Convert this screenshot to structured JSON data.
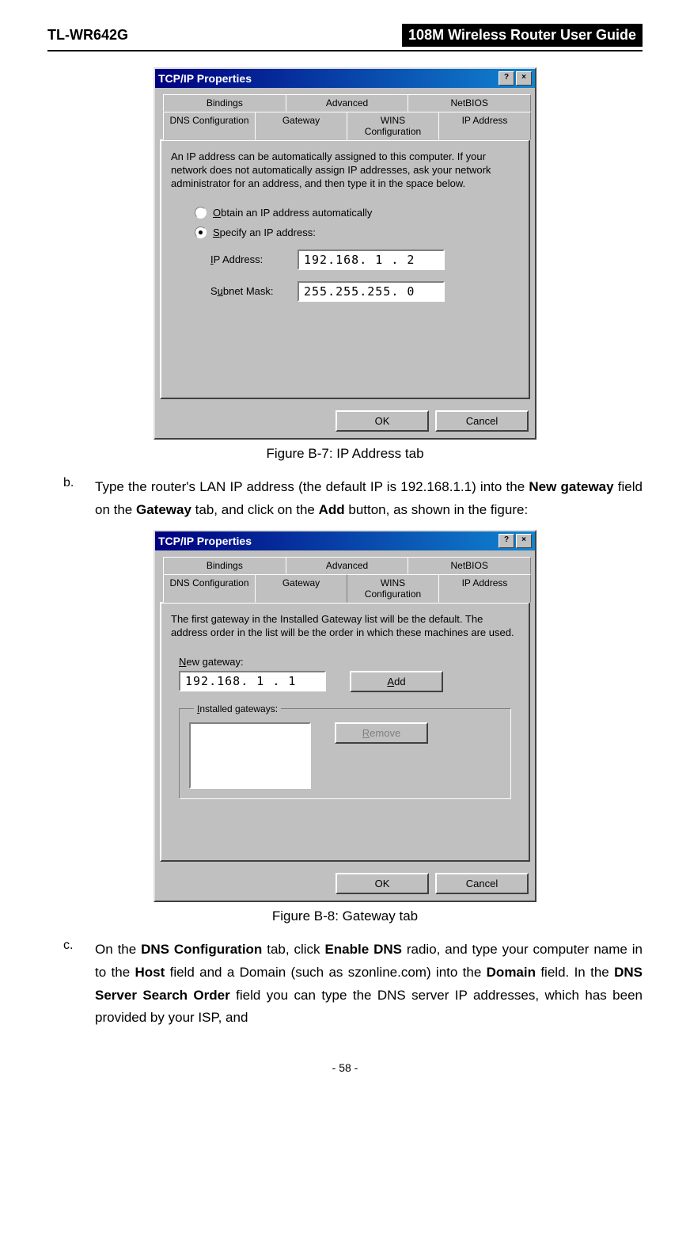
{
  "header": {
    "left": "TL-WR642G",
    "right": "108M Wireless Router User Guide"
  },
  "dialog1": {
    "title": "TCP/IP Properties",
    "help_btn": "?",
    "close_btn": "×",
    "tabs_row1": [
      "Bindings",
      "Advanced",
      "NetBIOS"
    ],
    "tabs_row2": [
      "DNS Configuration",
      "Gateway",
      "WINS Configuration",
      "IP Address"
    ],
    "description": "An IP address can be automatically assigned to this computer. If your network does not automatically assign IP addresses, ask your network administrator for an address, and then type it in the space below.",
    "radio_obtain": "Obtain an IP address automatically",
    "radio_specify": "Specify an IP address:",
    "ip_label": "IP Address:",
    "ip_value": "192.168. 1 . 2",
    "subnet_label": "Subnet Mask:",
    "subnet_value": "255.255.255. 0",
    "ok": "OK",
    "cancel": "Cancel"
  },
  "caption1": "Figure B-7: IP Address tab",
  "step_b": {
    "marker": "b.",
    "text_pre": "Type the router's LAN IP address (the default IP is 192.168.1.1) into the ",
    "bold1": "New gateway",
    "text_mid1": " field on the ",
    "bold2": "Gateway",
    "text_mid2": " tab, and click on the ",
    "bold3": "Add",
    "text_end": " button, as shown in the figure:"
  },
  "dialog2": {
    "title": "TCP/IP Properties",
    "help_btn": "?",
    "close_btn": "×",
    "tabs_row1": [
      "Bindings",
      "Advanced",
      "NetBIOS"
    ],
    "tabs_row2": [
      "DNS Configuration",
      "Gateway",
      "WINS Configuration",
      "IP Address"
    ],
    "description": "The first gateway in the Installed Gateway list will be the default. The address order in the list will be the order in which these machines are used.",
    "new_gateway_label": "New gateway:",
    "new_gateway_value": "192.168. 1 . 1",
    "add": "Add",
    "installed_label": "Installed gateways:",
    "remove": "Remove",
    "ok": "OK",
    "cancel": "Cancel"
  },
  "caption2": "Figure B-8: Gateway tab",
  "step_c": {
    "marker": "c.",
    "text1": "On the ",
    "bold1": "DNS Configuration",
    "text2": " tab, click ",
    "bold2": "Enable DNS",
    "text3": " radio, and type your computer name in to the ",
    "bold3": "Host",
    "text4": " field and a Domain (such as szonline.com) into the ",
    "bold4": "Domain",
    "text5": " field. In the ",
    "bold5": "DNS Server Search Order",
    "text6": " field you can type the DNS server IP addresses, which has been provided by your ISP, and"
  },
  "page_number": "- 58 -"
}
